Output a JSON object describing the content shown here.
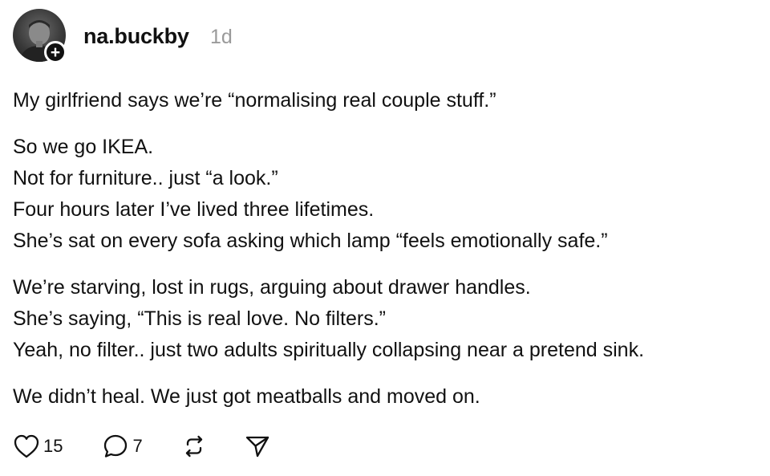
{
  "post": {
    "author": {
      "username": "na.buckby",
      "time": "1d",
      "follow_icon": "plus-icon"
    },
    "paragraphs": [
      [
        "My girlfriend says we’re “normalising real couple stuff.”"
      ],
      [
        "So we go IKEA.",
        "Not for furniture.. just “a look.”",
        "Four hours later I’ve lived three lifetimes.",
        "She’s sat on every sofa asking which lamp “feels emotionally safe.”"
      ],
      [
        "We’re starving, lost in rugs, arguing about drawer handles.",
        "She’s saying, “This is real love. No filters.”",
        "Yeah, no filter.. just two adults spiritually collapsing near a pretend sink."
      ],
      [
        "We didn’t heal. We just got meatballs and moved on."
      ]
    ],
    "actions": {
      "likes": "15",
      "replies": "7",
      "like_icon": "heart-icon",
      "reply_icon": "comment-icon",
      "repost_icon": "repost-icon",
      "share_icon": "send-icon"
    }
  }
}
